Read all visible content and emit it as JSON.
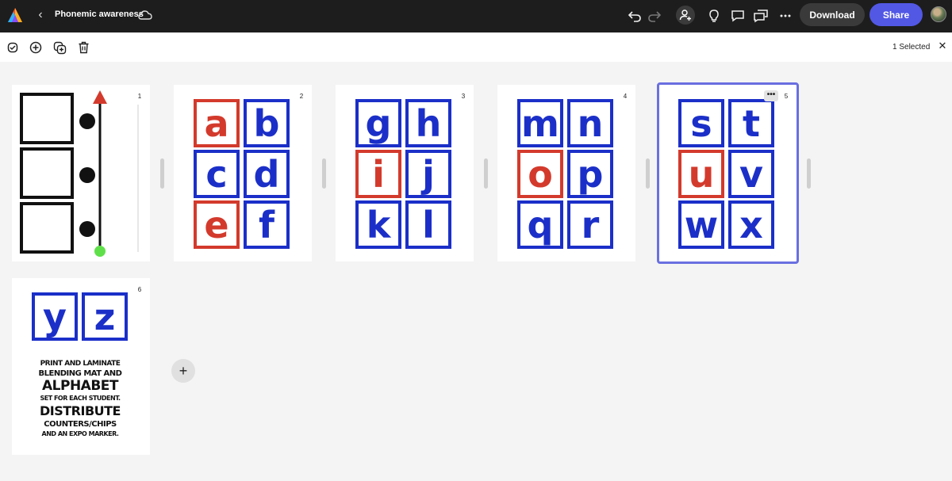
{
  "header": {
    "doc_title": "Phonemic awareness",
    "download_label": "Download",
    "share_label": "Share"
  },
  "toolbar": {
    "selection_status": "1 Selected"
  },
  "pages": [
    {
      "number": "1"
    },
    {
      "number": "2",
      "letters": [
        "a",
        "b",
        "c",
        "d",
        "e",
        "f"
      ],
      "red": [
        true,
        false,
        false,
        false,
        true,
        false
      ]
    },
    {
      "number": "3",
      "letters": [
        "g",
        "h",
        "i",
        "j",
        "k",
        "l"
      ],
      "red": [
        false,
        false,
        true,
        false,
        false,
        false
      ]
    },
    {
      "number": "4",
      "letters": [
        "m",
        "n",
        "o",
        "p",
        "q",
        "r"
      ],
      "red": [
        false,
        false,
        true,
        false,
        false,
        false
      ]
    },
    {
      "number": "5",
      "letters": [
        "s",
        "t",
        "u",
        "v",
        "w",
        "x"
      ],
      "red": [
        false,
        false,
        true,
        false,
        false,
        false
      ],
      "selected": true
    },
    {
      "number": "6",
      "letters": [
        "y",
        "z"
      ],
      "note_lines": [
        "PRINT AND LAMINATE",
        "BLENDING MAT AND",
        "ALPHABET",
        "SET FOR EACH STUDENT.",
        "DISTRIBUTE",
        "COUNTERS/CHIPS",
        "AND AN EXPO MARKER."
      ]
    }
  ],
  "more_label": "•••",
  "add_page_label": "+",
  "colors": {
    "accent": "#5258e4",
    "letter_blue": "#1b2fc8",
    "letter_red": "#d33a2c",
    "selection": "#6a6fe0"
  },
  "icons": [
    "adobe-express-logo",
    "chevron-left-icon",
    "cloud-icon",
    "undo-icon",
    "redo-icon",
    "invite-user-icon",
    "lightbulb-icon",
    "comment-icon",
    "chat-icon",
    "more-icon",
    "select-all-icon",
    "add-icon",
    "duplicate-icon",
    "trash-icon",
    "close-icon"
  ]
}
